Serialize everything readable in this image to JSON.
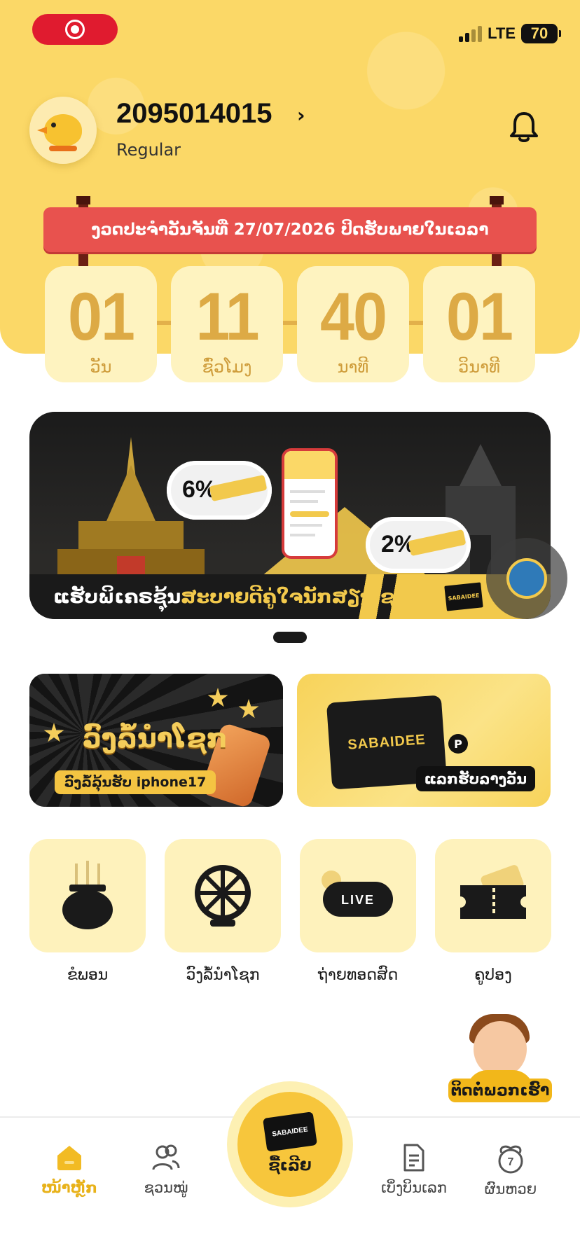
{
  "status_bar": {
    "network": "LTE",
    "battery": "70"
  },
  "profile": {
    "user_id": "2095014015",
    "tier": "Regular"
  },
  "draw": {
    "banner_text": "ງວດປະຈຳວັນຈັນທີ່ 27/07/2026 ປິດຮັບພາຍໃນເວລາ"
  },
  "countdown": [
    {
      "value": "01",
      "label": "ວັນ"
    },
    {
      "value": "11",
      "label": "ຊົ່ວໂມງ"
    },
    {
      "value": "40",
      "label": "ນາທີ"
    },
    {
      "value": "01",
      "label": "ວິນາທີ"
    }
  ],
  "promo": {
    "caption_part1": "ແຮັບພິເຄຣຊຸ້ນ",
    "caption_part2": "ສະບາຍດີຄູ່ໃຈນັກສຽງໂຊກ",
    "cloud1_pct": "6%",
    "cloud2_pct": "2%",
    "brand": "SABAIDEE"
  },
  "features": {
    "wheel": {
      "title": "ວົງລໍ້ນຳໂຊກ",
      "cta": "ວົງລໍ້ລຸ້ນຮັບ iphone17"
    },
    "exchange": {
      "brand": "SABAIDEE",
      "cta": "ແລກຮັບລາງວັນ"
    }
  },
  "quick_menu": [
    {
      "label": "ຂໍພອນ",
      "icon": "pot-icon"
    },
    {
      "label": "ວົງລໍ້ນຳໂຊກ",
      "icon": "wheel-icon"
    },
    {
      "label": "ຖ່າຍທອດສົດ",
      "icon": "live-icon"
    },
    {
      "label": "ຄູປອງ",
      "icon": "coupon-icon"
    }
  ],
  "support": {
    "label": "ຕິດຕໍ່ພວກເຮົາ"
  },
  "bottom_nav": {
    "home": "ໜ້າຫຼັກ",
    "invite": "ຊວນໝູ່",
    "buy": "ຊື້ເລີຍ",
    "buy_brand": "SABAIDEE",
    "tickets": "ເບິ່ງບິນເລກ",
    "results": "ຜົນຫວຍ"
  },
  "colors": {
    "accent": "#f7c63c",
    "header": "#fbd867",
    "banner": "#e8524e",
    "active": "#e8b21a"
  }
}
